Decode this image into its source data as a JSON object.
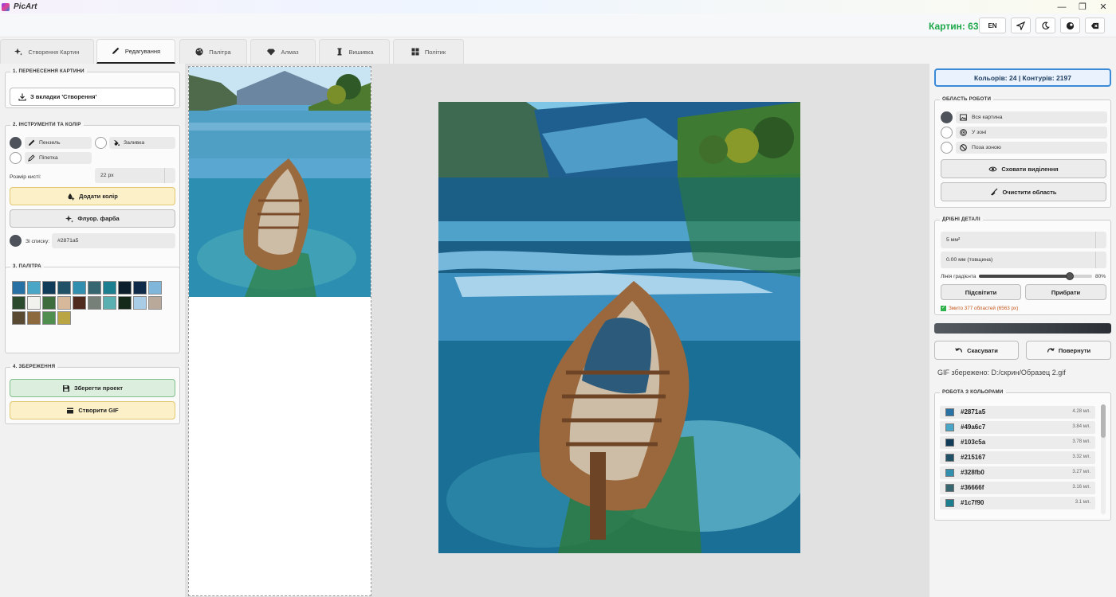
{
  "app": {
    "title": "PicArt",
    "window_controls": {
      "minimize": "—",
      "restore": "❐",
      "close": "✕"
    }
  },
  "header": {
    "count": "Картин: 63",
    "lang": "EN",
    "icons": [
      "navigate-icon",
      "moon-icon",
      "theme-icon",
      "backspace-icon"
    ]
  },
  "tabs": [
    {
      "label": "Створення Картин",
      "icon": "sparkle-icon"
    },
    {
      "label": "Редагування",
      "icon": "brush-icon",
      "active": true
    },
    {
      "label": "Палітра",
      "icon": "palette-icon"
    },
    {
      "label": "Алмаз",
      "icon": "diamond-icon"
    },
    {
      "label": "Вишивка",
      "icon": "thread-icon"
    },
    {
      "label": "Політик",
      "icon": "grid-icon"
    }
  ],
  "left": {
    "s1": {
      "title": "1. ПЕРЕНЕСЕННЯ КАРТИНИ",
      "from_tab": "З вкладки 'Створення'"
    },
    "s2": {
      "title": "2. ІНСТРУМЕНТИ ТА КОЛІР",
      "brush": "Пензель",
      "fill": "Заливка",
      "pipette": "Піпетка",
      "brush_size_label": "Розмір кисті:",
      "brush_size": "22 px",
      "add_color": "Додати колір",
      "fluor": "Флуор. фарба",
      "from_list": "Зі списку:",
      "from_list_value": "#2871a5"
    },
    "s3": {
      "title": "3. ПАЛІТРА",
      "colors": [
        "#2871a5",
        "#49a6c7",
        "#103c5a",
        "#215167",
        "#328fb0",
        "#36666f",
        "#1c7f90",
        "#0d1f2c",
        "#102b4a",
        "#7fb6d9",
        "#2b4a2e",
        "#f1f2ee",
        "#3f6c3c",
        "#d8b89a",
        "#4f2a1e",
        "#777f79",
        "#5ab0b0",
        "#15291a",
        "#a9cde6",
        "#b8a99a",
        "#5b4a33",
        "#8c6a3d",
        "#4f8e4f",
        "#b9a544"
      ]
    },
    "s4": {
      "title": "4. ЗБЕРЕЖЕННЯ",
      "save": "Зберегти проект",
      "gif": "Створити GIF"
    }
  },
  "right": {
    "stats": "Кольорів: 24 | Контурів: 2197",
    "area": {
      "title": "ОБЛАСТЬ РОБОТИ",
      "whole": "Вся картина",
      "in_zone": "У зоні",
      "out_zone": "Поза зоною",
      "hide": "Сховати виділення",
      "clear": "Очистити область"
    },
    "details": {
      "title": "ДРІБНІ ДЕТАЛІ",
      "area_value": "5 мм²",
      "thickness": "0.00 мм (товщина)",
      "gradient_label": "Лінія градієнта",
      "gradient_pct": "80%",
      "gradient_level": 0.8,
      "highlight": "Підсвітити",
      "remove": "Прибрати",
      "status": "Змито 377 областей (6563 px)"
    },
    "undo": "Скасувати",
    "redo": "Повернути",
    "gif_saved": "GIF збережено: D:/скрин/Образец 2.gif",
    "colors": {
      "title": "РОБОТА З КОЛЬОРАМИ",
      "items": [
        {
          "hex": "#2871a5",
          "mm": "4.28 мл."
        },
        {
          "hex": "#49a6c7",
          "mm": "3.84 мл."
        },
        {
          "hex": "#103c5a",
          "mm": "3.78 мл."
        },
        {
          "hex": "#215167",
          "mm": "3.32 мл."
        },
        {
          "hex": "#328fb0",
          "mm": "3.27 мл."
        },
        {
          "hex": "#36666f",
          "mm": "3.16 мл."
        },
        {
          "hex": "#1c7f90",
          "mm": "3.1 мл."
        }
      ]
    }
  }
}
